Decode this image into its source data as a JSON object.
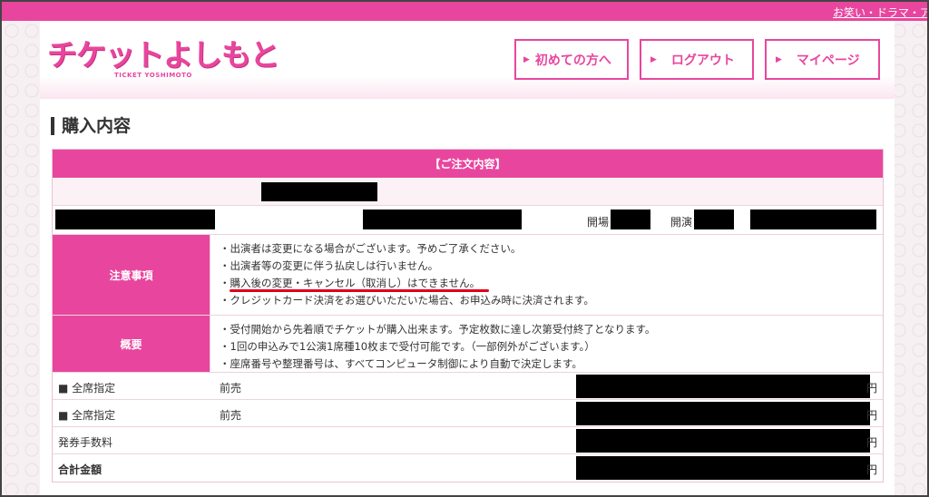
{
  "topbar": {
    "link_text": "お笑い・ドラマ・ア"
  },
  "logo": {
    "main": "チケットよしもと",
    "sub": "TICKET YOSHIMOTO"
  },
  "nav": {
    "first_time": "初めての方へ",
    "logout": "ログアウト",
    "mypage": "マイページ",
    "arrow_icon": "▶"
  },
  "page_title": "購入内容",
  "order": {
    "header": "【ご注文内容】",
    "venue_label": "開場",
    "start_label": "開演",
    "notes": {
      "label": "注意事項",
      "lines": [
        "・出演者は変更になる場合がございます。予めご了承ください。",
        "・出演者等の変更に伴う払戻しは行いません。",
        "・購入後の変更・キャンセル（取消し）はできません。",
        "・クレジットカード決済をお選びいただいた場合、お申込み時に決済されます。"
      ]
    },
    "overview": {
      "label": "概要",
      "lines": [
        "・受付開始から先着順でチケットが購入出来ます。予定枚数に達し次第受付終了となります。",
        "・1回の申込みで1公演1席種10枚まで受付可能です。（一部例外がございます。）",
        "・座席番号や整理番号は、すべてコンピュータ制御により自動で決定します。"
      ]
    },
    "prices": [
      {
        "label": "■ 全席指定",
        "kind": "前売",
        "unit": "円"
      },
      {
        "label": "■ 全席指定",
        "kind": "前売",
        "unit": "円"
      },
      {
        "label": "発券手数料",
        "kind": "",
        "unit": "円"
      },
      {
        "label": "合計金額",
        "kind": "",
        "unit": "円"
      }
    ]
  },
  "colors": {
    "accent": "#e8469e",
    "highlight": "#e0001b"
  }
}
